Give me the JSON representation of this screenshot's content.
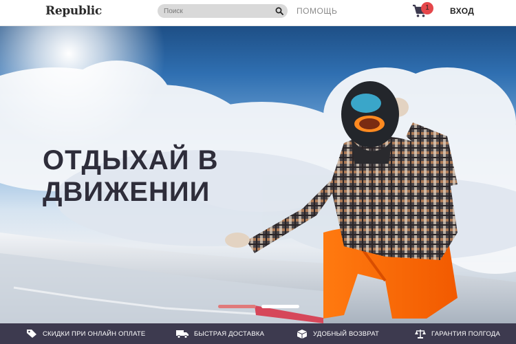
{
  "header": {
    "logo": "Republic",
    "search_placeholder": "Поиск",
    "search_value": "",
    "help_label": "ПОМОЩЬ",
    "cart_count": "1",
    "login_label": "ВХОД"
  },
  "hero": {
    "headline": "ОТДЫХАЙ В ДВИЖЕНИИ",
    "slides": [
      {
        "active": true
      },
      {
        "active": false
      }
    ]
  },
  "benefits": [
    {
      "label": "СКИДКИ ПРИ ОНЛАЙН ОПЛАТЕ",
      "icon": "tag-icon"
    },
    {
      "label": "БЫСТРАЯ ДОСТАВКА",
      "icon": "truck-icon"
    },
    {
      "label": "УДОБНЫЙ ВОЗВРАТ",
      "icon": "box-return-icon"
    },
    {
      "label": "ГАРАНТИЯ ПОЛГОДА",
      "icon": "scales-icon"
    }
  ],
  "colors": {
    "badge": "#e5474b",
    "benefits_bar": "#3d3a4f",
    "headline": "#2e2d3a",
    "active_slide": "#e07a7a"
  }
}
